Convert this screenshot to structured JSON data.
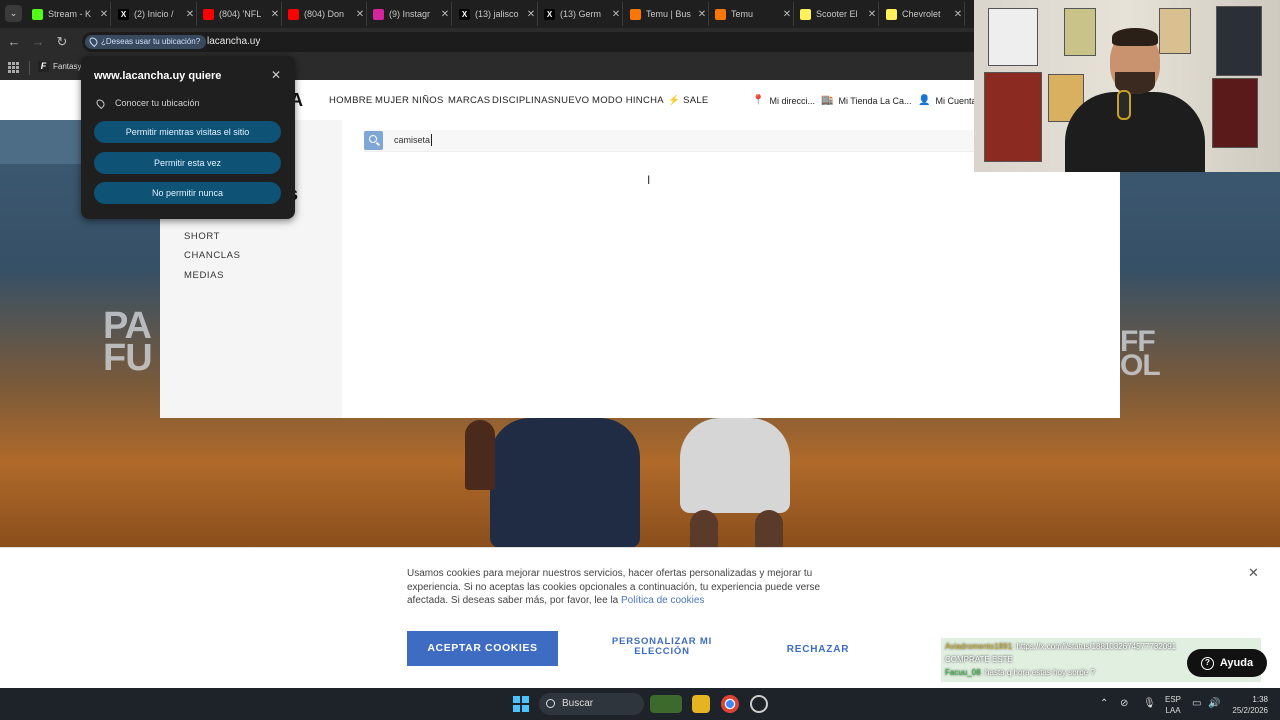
{
  "browser": {
    "tabs": [
      {
        "title": "Stream - K",
        "icon": "kick-icon",
        "color": "#53fc18"
      },
      {
        "title": "(2) Inicio /",
        "icon": "x-icon",
        "color": "#000000"
      },
      {
        "title": "(804) 'NFL",
        "icon": "youtube-icon",
        "color": "#ff0000"
      },
      {
        "title": "(804) Don",
        "icon": "youtube-icon",
        "color": "#ff0000"
      },
      {
        "title": "(9) Instagr",
        "icon": "instagram-icon",
        "color": "#d6249f"
      },
      {
        "title": "(13) jalisco",
        "icon": "x-icon",
        "color": "#000000"
      },
      {
        "title": "(13) Germ",
        "icon": "x-icon",
        "color": "#000000"
      },
      {
        "title": "Temu | Bus",
        "icon": "temu-icon",
        "color": "#fb7701"
      },
      {
        "title": "Temu",
        "icon": "temu-icon",
        "color": "#fb7701"
      },
      {
        "title": "Scooter El",
        "icon": "mercadolibre-icon",
        "color": "#fff159"
      },
      {
        "title": "Chevrolet",
        "icon": "mercadolibre-icon",
        "color": "#fff159"
      }
    ],
    "location_chip": "¿Deseas usar tu ubicación?",
    "url": "lacancha.uy",
    "bookmark": "Fantasy"
  },
  "permission_popup": {
    "title": "www.lacancha.uy quiere",
    "know_location": "Conocer tu ubicación",
    "allow_always": "Permitir mientras visitas el sitio",
    "allow_once": "Permitir esta vez",
    "never_allow": "No permitir nunca"
  },
  "site": {
    "logo_fragment": "A",
    "nav": [
      "HOMBRE",
      "MUJER",
      "NIÑOS",
      "MARCAS",
      "DISCIPLINAS",
      "NUEVO",
      "MODO HINCHA",
      "SALE"
    ],
    "address": "Mi direcci...",
    "store": "Mi Tienda La Ca...",
    "account": "Mi Cuenta",
    "hero_left": "PA\nFU",
    "hero_right": "FF\nOL"
  },
  "search": {
    "value": "camiseta",
    "side_heading_fragment": "s",
    "suggestions": [
      "SHORT",
      "CHANCLAS",
      "MEDIAS"
    ]
  },
  "cookies": {
    "text": "Usamos cookies para mejorar nuestros servicios, hacer ofertas personalizadas y mejorar tu experiencia. Si no aceptas las cookies opcionales a continuación, tu experiencia puede verse afectada. Si deseas saber más, por favor, lee la",
    "link": "Política de cookies",
    "accept": "ACEPTAR COOKIES",
    "customize": "PERSONALIZAR MI ELECCIÓN",
    "reject": "RECHAZAR"
  },
  "chat": {
    "user1": "Aviadromento1891",
    "msg1": ": https://x.com/i/status/1881032674577732091",
    "line2": "COMPRATE ESTE",
    "user2": "Facuu_08",
    "msg2": ": hasta q hora estas hoy sorde ?"
  },
  "help_button": "Ayuda",
  "taskbar": {
    "search": "Buscar",
    "lang1": "ESP",
    "lang2": "LAA",
    "time": "1:38",
    "date": "25/2/2026"
  },
  "colors": {
    "accent": "#3d6cc2",
    "popup_button": "#0e5276",
    "search_button": "#7fa7d6"
  }
}
